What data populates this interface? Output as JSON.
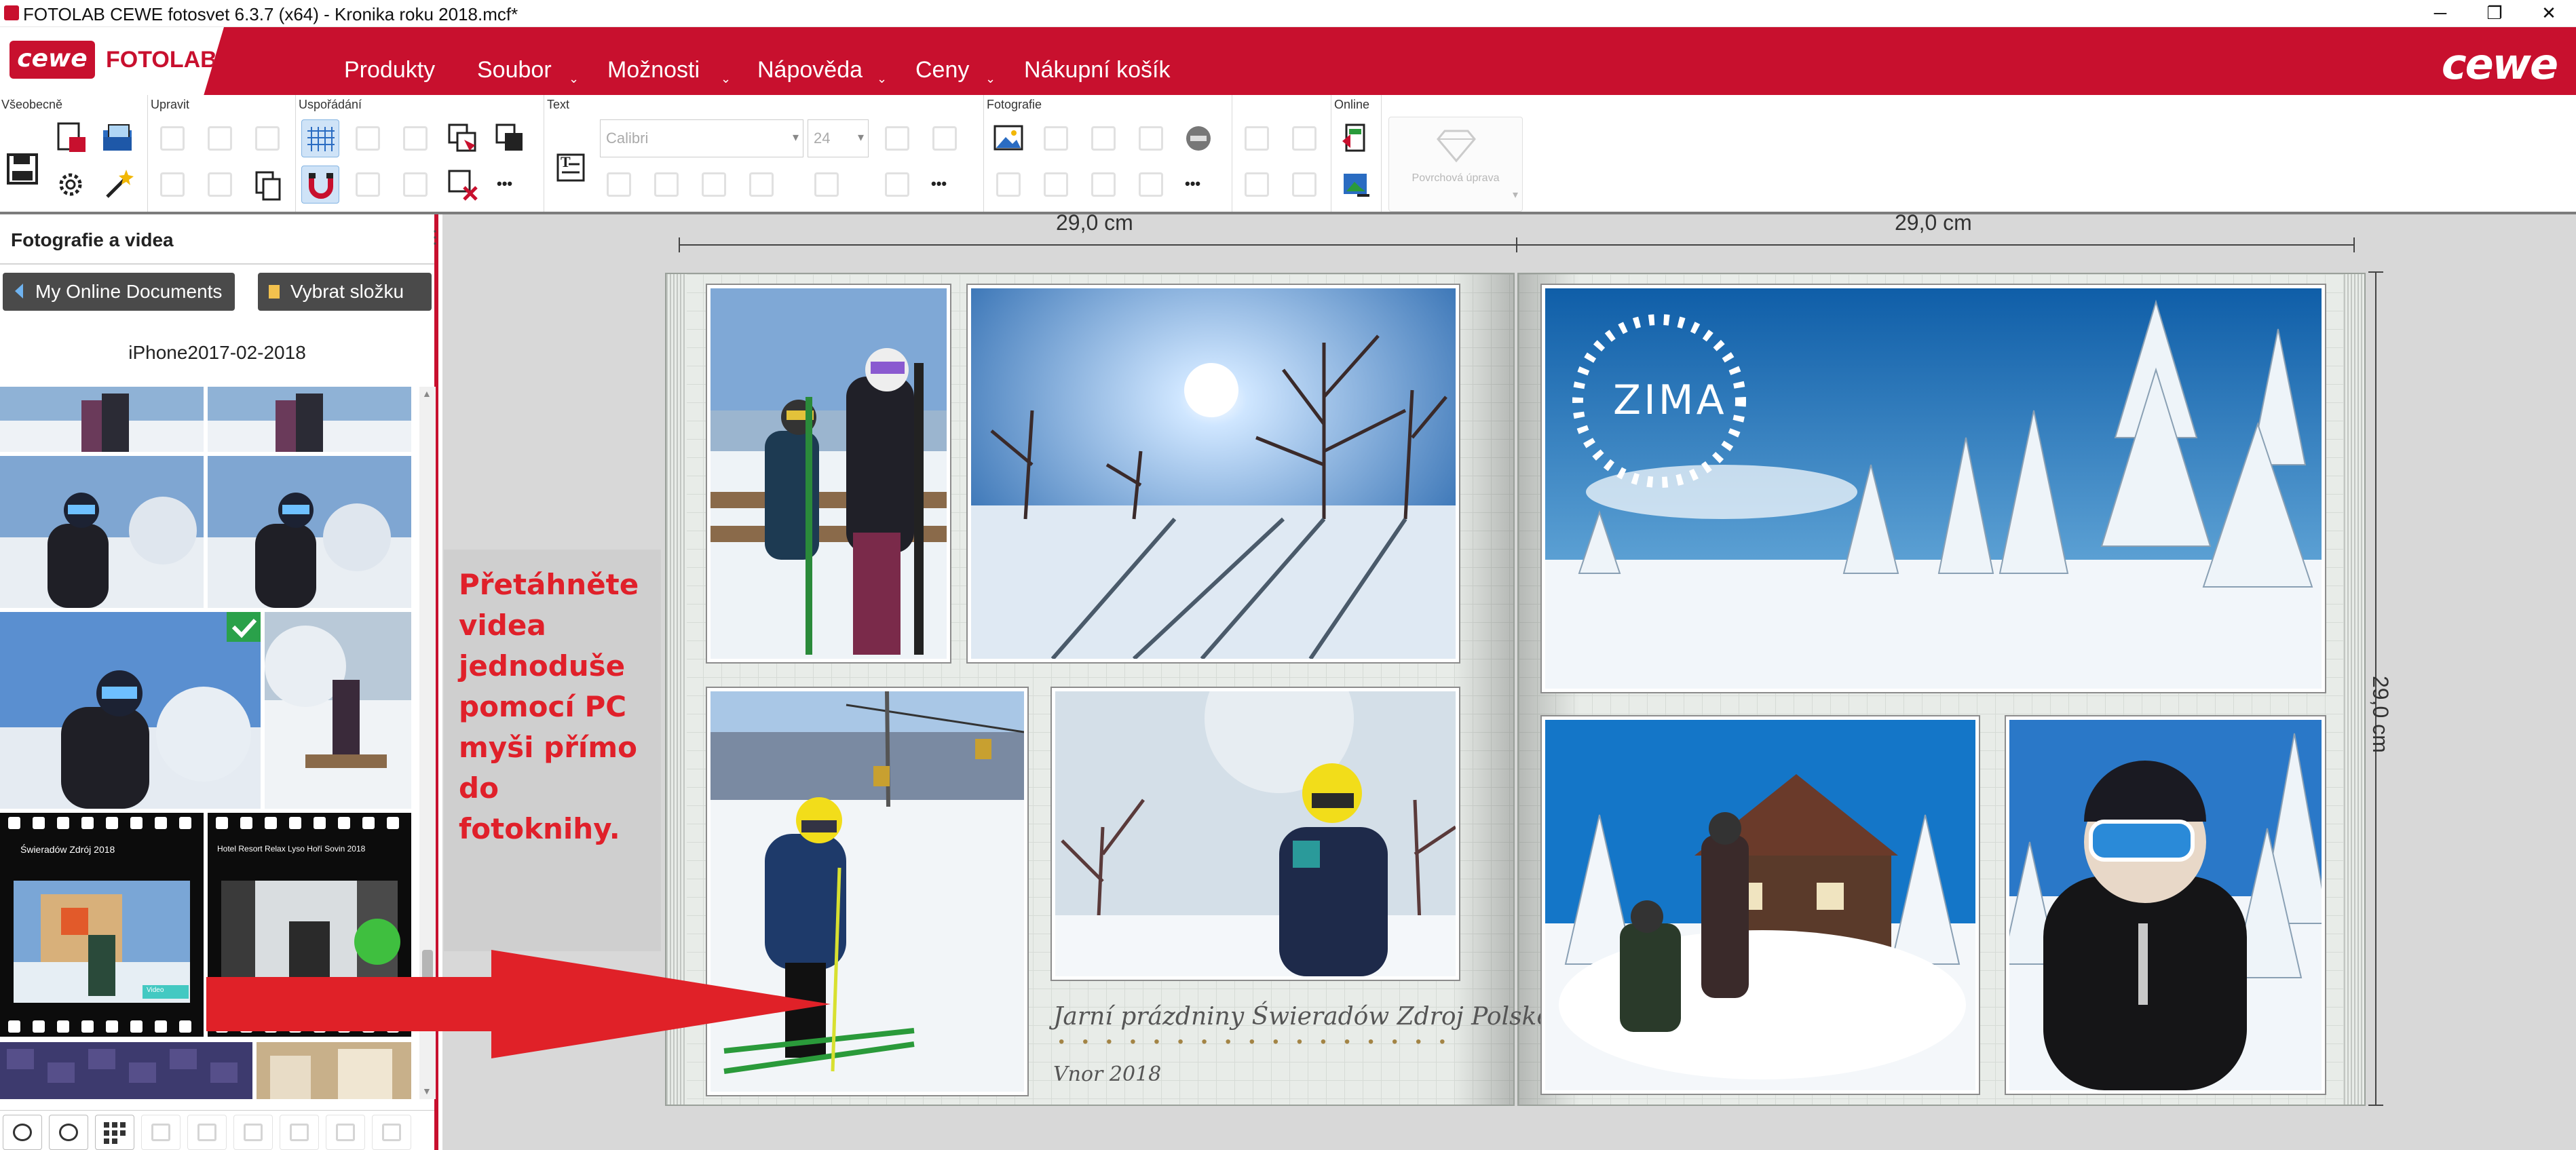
{
  "window": {
    "title": "FOTOLAB CEWE fotosvet 6.3.7 (x64) - Kronika roku 2018.mcf*",
    "controls": [
      "─",
      "❐",
      "✕"
    ]
  },
  "menubar": {
    "cewe_badge": "cewe",
    "fotolab_logo": "FOTOLAB",
    "items": [
      "Produkty",
      "Soubor",
      "Možnosti",
      "Nápověda",
      "Ceny",
      "Nákupní košík"
    ],
    "caret": "⌄",
    "brand_right": "cewe",
    "brand_color": "#c8102e"
  },
  "toolbar": {
    "groups": [
      "Všeobecně",
      "Upravit",
      "Uspořádání",
      "Text",
      "Fotografie",
      "",
      "Online",
      ""
    ],
    "font_name": "Calibri",
    "font_size": "24",
    "dropdown_caret": "▾",
    "surface_label": "Povrchová úprava",
    "more": "•••"
  },
  "leftpanel": {
    "title": "Fotografie a videa",
    "menu_dots": "⋮",
    "nav_back": "My Online Documents",
    "nav_folder": "Vybrat složku",
    "folder_name": "iPhone2017-02-2018",
    "video1_title": "Świeradów Zdrój 2018",
    "video1_badge": "Video",
    "video2_title": "Hotel Resort Relax Lyso Hoří Sovin 2018",
    "scroll_up": "▲",
    "scroll_down": "▼"
  },
  "callout": {
    "text": "Přetáhněte videa jednoduše pomocí PC myši přímo do fotoknihy.",
    "color": "#e0202a"
  },
  "book": {
    "width_left": "29,0 cm",
    "width_right": "29,0 cm",
    "height": "29,0 cm",
    "zima_label": "ZIMA",
    "caption_title": "Jarní prázdniny Świeradów Zdroj Polsko",
    "caption_dots": "• • • • • • • • • • • • • • • • •",
    "caption_date": "Vnor 2018"
  }
}
